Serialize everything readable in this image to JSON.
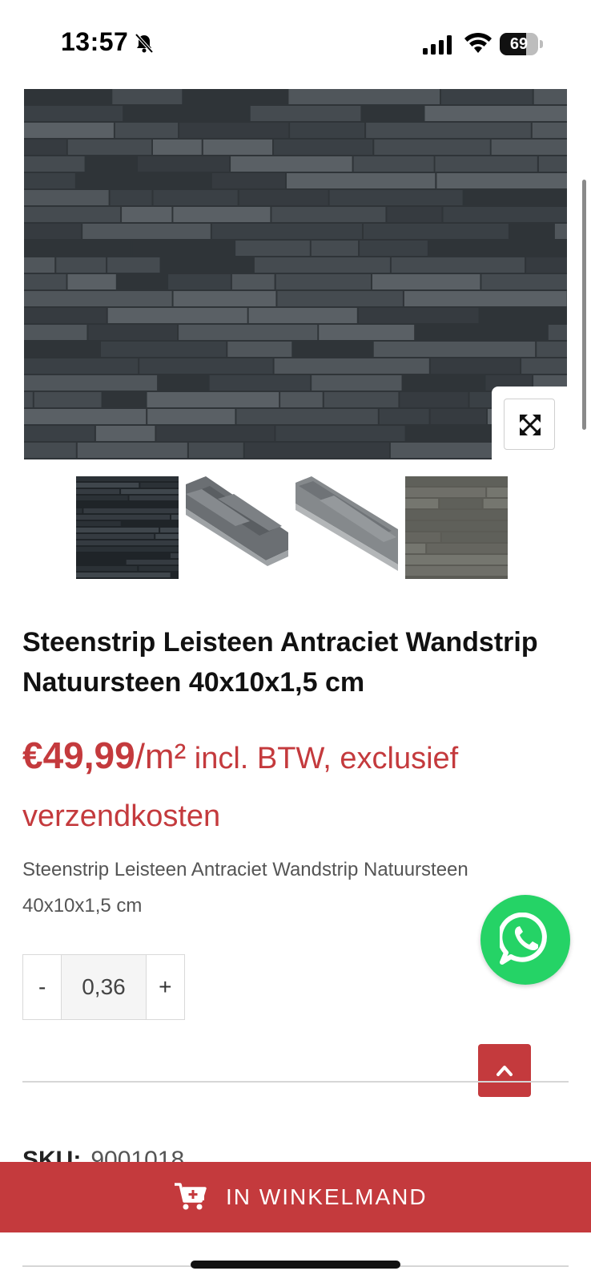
{
  "status_bar": {
    "time": "13:57",
    "battery": "69",
    "battery_level": 0.69,
    "icons": [
      "bell-slash-icon",
      "cellular-signal-icon",
      "wifi-icon",
      "battery-icon"
    ]
  },
  "gallery": {
    "main_image_alt": "Steenstrip Leisteen Antraciet wandstrip",
    "zoom_icon": "expand-icon",
    "thumbnails": [
      "thumb-wall",
      "thumb-strip-angle",
      "thumb-strip-diagonal",
      "thumb-wall-grey"
    ]
  },
  "product": {
    "title": "Steenstrip Leisteen Antraciet Wandstrip Natuursteen 40x10x1,5 cm",
    "price_amount": "€49,99",
    "price_unit": "/m²",
    "price_suffix": " incl. BTW, exclusief verzendkosten",
    "short_description": "Steenstrip Leisteen Antraciet Wandstrip Natuursteen 40x10x1,5 cm"
  },
  "quantity": {
    "minus_label": "-",
    "value": "0,36",
    "plus_label": "+"
  },
  "meta": {
    "sku_label": "SKU:",
    "sku_value": "9001018"
  },
  "cart": {
    "button_label": "IN WINKELMAND",
    "icon": "cart-plus-icon"
  },
  "floating": {
    "whatsapp_icon": "whatsapp-icon",
    "scroll_top_icon": "chevron-up-icon"
  },
  "colors": {
    "accent": "#c43a3d",
    "whatsapp": "#25d366",
    "text_muted": "#555555"
  }
}
